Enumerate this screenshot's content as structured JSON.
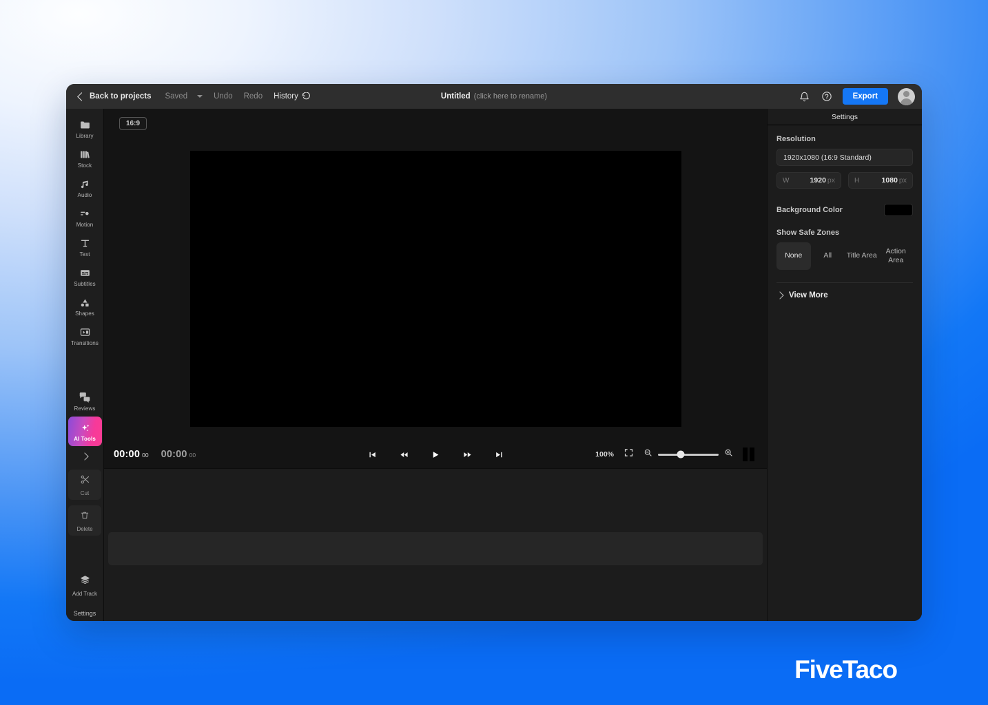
{
  "topbar": {
    "back_label": "Back to projects",
    "saved_label": "Saved",
    "undo_label": "Undo",
    "redo_label": "Redo",
    "history_label": "History",
    "project_name": "Untitled",
    "project_rename_hint": "(click here to rename)",
    "export_label": "Export",
    "icons": {
      "back_chevron": "chevron-left-icon",
      "saved_caret": "chevron-down-icon",
      "history": "history-undo-icon",
      "notifications": "bell-icon",
      "help": "question-circle-icon",
      "avatar": "user-avatar"
    }
  },
  "sidebar": {
    "items": [
      {
        "label": "Library",
        "icon": "folder-icon"
      },
      {
        "label": "Stock",
        "icon": "books-icon"
      },
      {
        "label": "Audio",
        "icon": "music-note-icon"
      },
      {
        "label": "Motion",
        "icon": "motion-slider-icon"
      },
      {
        "label": "Text",
        "icon": "text-t-icon"
      },
      {
        "label": "Subtitles",
        "icon": "subtitles-icon"
      },
      {
        "label": "Shapes",
        "icon": "shapes-icon"
      },
      {
        "label": "Transitions",
        "icon": "transitions-icon"
      }
    ],
    "reviews": {
      "label": "Reviews",
      "icon": "speech-bubbles-icon"
    },
    "ai_tools": {
      "label": "AI Tools",
      "icon": "sparkle-icon",
      "gradient_from": "#8b4bd8",
      "gradient_to": "#fb3d93"
    },
    "expand": {
      "icon": "chevron-right-icon"
    },
    "tools": [
      {
        "label": "Cut",
        "icon": "scissors-icon"
      },
      {
        "label": "Delete",
        "icon": "trash-icon"
      }
    ],
    "add_track": {
      "label": "Add Track",
      "icon": "layers-add-icon"
    },
    "settings_link": "Settings"
  },
  "stage": {
    "ratio_badge": "16:9",
    "canvas_background": "#000000"
  },
  "playback": {
    "current_time": {
      "main": "00:00",
      "frames": "00"
    },
    "total_time": {
      "main": "00:00",
      "frames": "00"
    },
    "controls": [
      {
        "name": "skip-to-start-button",
        "icon": "skip-start-icon"
      },
      {
        "name": "rewind-button",
        "icon": "rewind-icon"
      },
      {
        "name": "play-button",
        "icon": "play-icon"
      },
      {
        "name": "fast-forward-button",
        "icon": "fast-forward-icon"
      },
      {
        "name": "skip-to-end-button",
        "icon": "skip-end-icon"
      }
    ],
    "zoom_percent": "100%",
    "fit_icon": "fit-to-screen-icon",
    "zoom_out_icon": "zoom-out-icon",
    "zoom_in_icon": "zoom-in-icon",
    "split_view_icon": "split-view-icon",
    "slider_value": 37
  },
  "settings": {
    "header": "Settings",
    "resolution_label": "Resolution",
    "resolution_value": "1920x1080 (16:9 Standard)",
    "width": {
      "key": "W",
      "value": "1920",
      "unit": "px"
    },
    "height": {
      "key": "H",
      "value": "1080",
      "unit": "px"
    },
    "background_color_label": "Background Color",
    "background_color_value": "#000000",
    "safe_zones_label": "Show Safe Zones",
    "safe_zone_options": [
      "None",
      "All",
      "Title Area",
      "Action Area"
    ],
    "safe_zone_selected": "None",
    "view_more_label": "View More",
    "view_more_icon": "chevron-right-icon"
  },
  "brand": {
    "name": "FiveTaco"
  }
}
